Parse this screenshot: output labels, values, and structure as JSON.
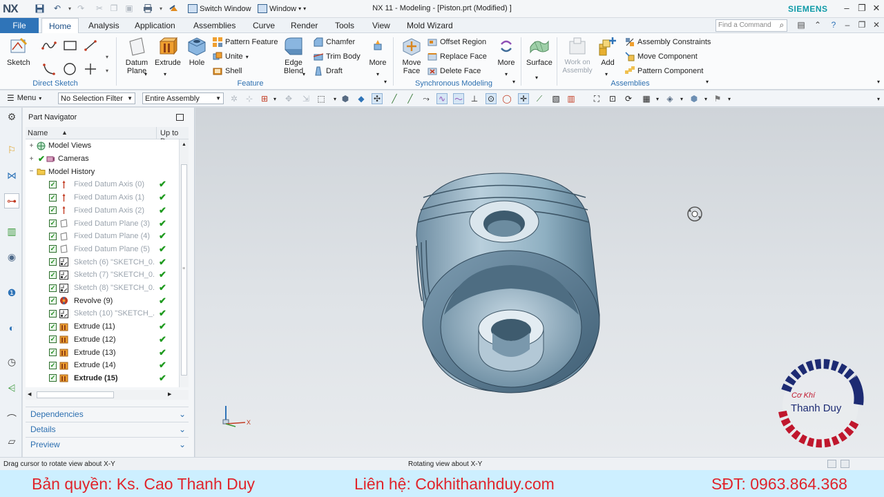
{
  "titlebar": {
    "logo": "NX",
    "switch_window": "Switch Window",
    "window_menu": "Window",
    "title": "NX 11 - Modeling - [Piston.prt (Modified) ]",
    "brand": "SIEMENS"
  },
  "menubar": {
    "file": "File",
    "tabs": [
      "Home",
      "Analysis",
      "Application",
      "Assemblies",
      "Curve",
      "Render",
      "Tools",
      "View",
      "Mold Wizard"
    ],
    "search_placeholder": "Find a Command"
  },
  "ribbon": {
    "direct_sketch": {
      "sketch": "Sketch",
      "label": "Direct Sketch"
    },
    "feature": {
      "datum_plane": "Datum Plane",
      "extrude": "Extrude",
      "hole": "Hole",
      "pattern_feature": "Pattern Feature",
      "unite": "Unite",
      "shell": "Shell",
      "edge_blend": "Edge Blend",
      "chamfer": "Chamfer",
      "trim_body": "Trim Body",
      "draft": "Draft",
      "more": "More",
      "label": "Feature"
    },
    "sync": {
      "move_face": "Move Face",
      "offset_region": "Offset Region",
      "replace_face": "Replace Face",
      "delete_face": "Delete Face",
      "more": "More",
      "label": "Synchronous Modeling"
    },
    "surface": {
      "surface": "Surface"
    },
    "assemblies": {
      "work_on_assembly": "Work on Assembly",
      "add": "Add",
      "assembly_constraints": "Assembly Constraints",
      "move_component": "Move Component",
      "pattern_component": "Pattern Component",
      "label": "Assemblies"
    }
  },
  "toolbar": {
    "menu": "Menu",
    "selection_filter": "No Selection Filter",
    "scope": "Entire Assembly"
  },
  "navigator": {
    "title": "Part Navigator",
    "col_name": "Name",
    "col_uptodate": "Up to Da",
    "rows": [
      {
        "label": "Model Views",
        "level": 0,
        "expander": "+",
        "check": false,
        "dim": false,
        "bold": false,
        "ok": false
      },
      {
        "label": "Cameras",
        "level": 0,
        "expander": "+",
        "check": false,
        "dim": false,
        "bold": false,
        "ok": false
      },
      {
        "label": "Model History",
        "level": 0,
        "expander": "−",
        "check": false,
        "dim": false,
        "bold": false,
        "ok": false
      },
      {
        "label": "Fixed Datum Axis (0)",
        "level": 1,
        "check": true,
        "dim": true,
        "bold": false,
        "ok": true,
        "icon": "datum-axis"
      },
      {
        "label": "Fixed Datum Axis (1)",
        "level": 1,
        "check": true,
        "dim": true,
        "bold": false,
        "ok": true,
        "icon": "datum-axis"
      },
      {
        "label": "Fixed Datum Axis (2)",
        "level": 1,
        "check": true,
        "dim": true,
        "bold": false,
        "ok": true,
        "icon": "datum-axis"
      },
      {
        "label": "Fixed Datum Plane (3)",
        "level": 1,
        "check": true,
        "dim": true,
        "bold": false,
        "ok": true,
        "icon": "datum-plane"
      },
      {
        "label": "Fixed Datum Plane (4)",
        "level": 1,
        "check": true,
        "dim": true,
        "bold": false,
        "ok": true,
        "icon": "datum-plane"
      },
      {
        "label": "Fixed Datum Plane (5)",
        "level": 1,
        "check": true,
        "dim": true,
        "bold": false,
        "ok": true,
        "icon": "datum-plane"
      },
      {
        "label": "Sketch (6) \"SKETCH_0...",
        "level": 1,
        "check": true,
        "dim": true,
        "bold": false,
        "ok": true,
        "icon": "sketch"
      },
      {
        "label": "Sketch (7) \"SKETCH_0...",
        "level": 1,
        "check": true,
        "dim": true,
        "bold": false,
        "ok": true,
        "icon": "sketch"
      },
      {
        "label": "Sketch (8) \"SKETCH_0...",
        "level": 1,
        "check": true,
        "dim": true,
        "bold": false,
        "ok": true,
        "icon": "sketch"
      },
      {
        "label": "Revolve (9)",
        "level": 1,
        "check": true,
        "dim": false,
        "bold": false,
        "ok": true,
        "icon": "revolve"
      },
      {
        "label": "Sketch (10) \"SKETCH_...",
        "level": 1,
        "check": true,
        "dim": true,
        "bold": false,
        "ok": true,
        "icon": "sketch"
      },
      {
        "label": "Extrude (11)",
        "level": 1,
        "check": true,
        "dim": false,
        "bold": false,
        "ok": true,
        "icon": "extrude"
      },
      {
        "label": "Extrude (12)",
        "level": 1,
        "check": true,
        "dim": false,
        "bold": false,
        "ok": true,
        "icon": "extrude"
      },
      {
        "label": "Extrude (13)",
        "level": 1,
        "check": true,
        "dim": false,
        "bold": false,
        "ok": true,
        "icon": "extrude"
      },
      {
        "label": "Extrude (14)",
        "level": 1,
        "check": true,
        "dim": false,
        "bold": false,
        "ok": true,
        "icon": "extrude"
      },
      {
        "label": "Extrude (15)",
        "level": 1,
        "check": true,
        "dim": false,
        "bold": true,
        "ok": true,
        "icon": "extrude"
      }
    ],
    "sections": [
      "Dependencies",
      "Details",
      "Preview"
    ]
  },
  "viewport": {
    "axis_label": "X",
    "watermark_logo": "Cơ Khí Thanh Duy"
  },
  "status": {
    "left": "Drag cursor to rotate view about X-Y",
    "middle": "Rotating view about X-Y"
  },
  "footer": {
    "copyright": "Bản quyền: Ks. Cao Thanh Duy",
    "contact": "Liên hệ: Cokhithanhduy.com",
    "phone": "SĐT: 0963.864.368"
  },
  "colors": {
    "accent": "#2f74b8",
    "brand": "#0e9aa7",
    "ok_green": "#1f9a1f",
    "footer_text": "#e0242b",
    "footer_bg": "#cdefff"
  }
}
